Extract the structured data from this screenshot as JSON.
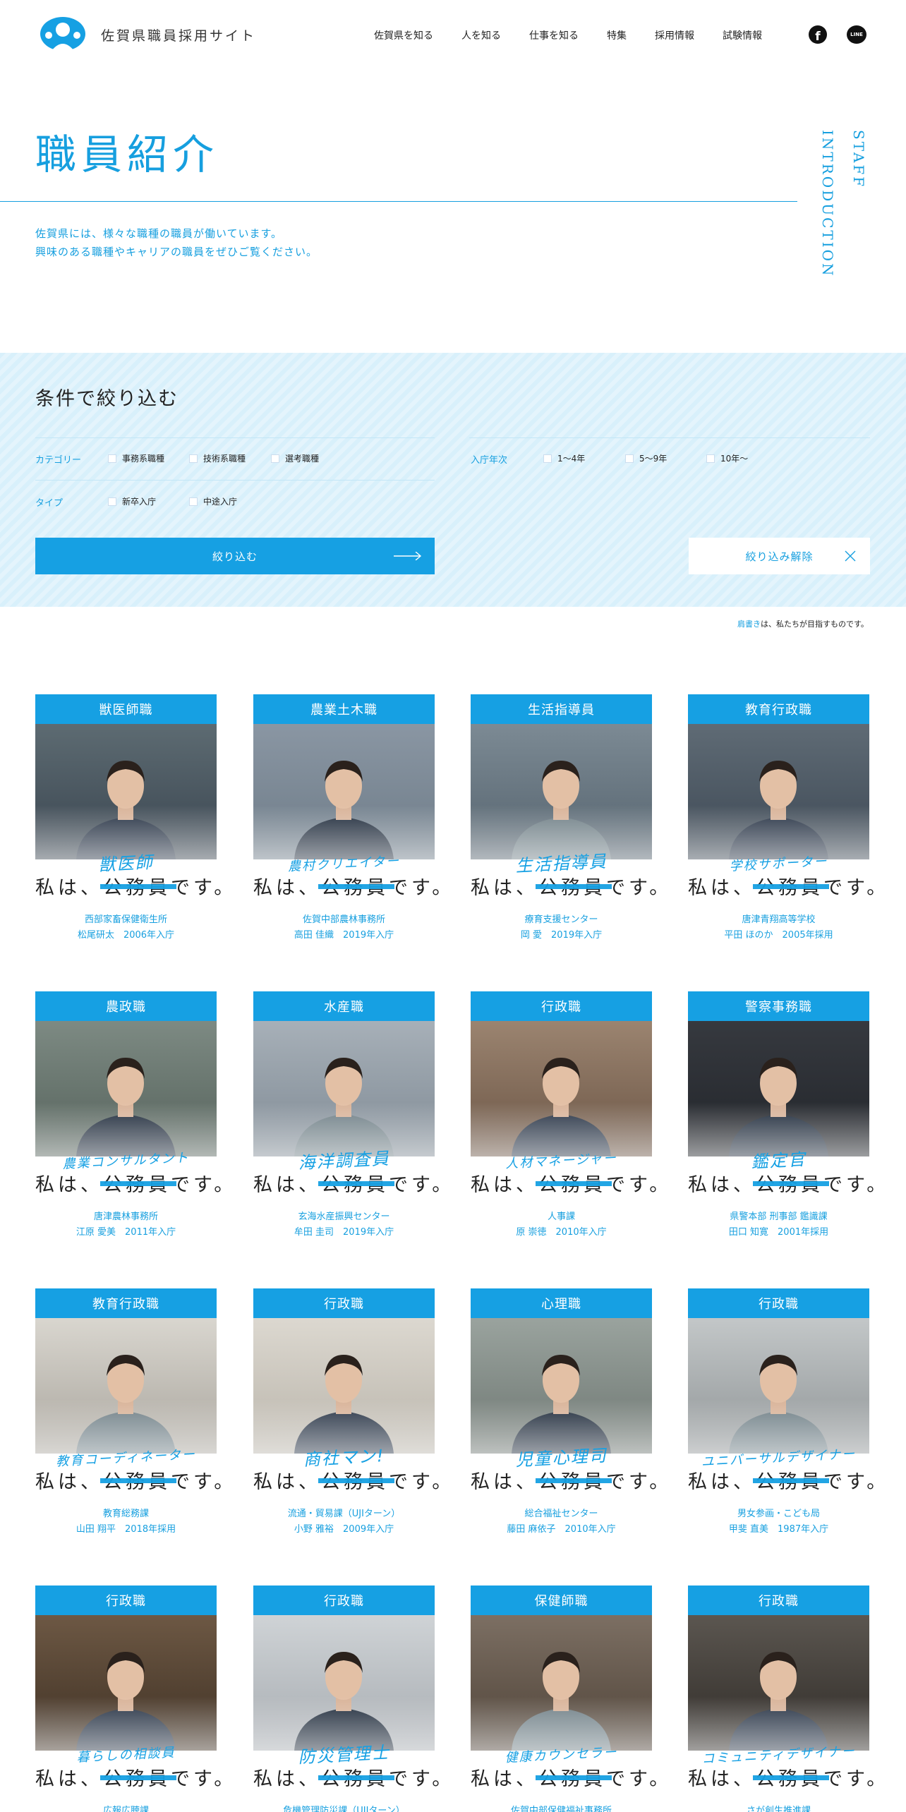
{
  "header": {
    "site_title": "佐賀県職員採用サイト",
    "nav": [
      "佐賀県を知る",
      "人を知る",
      "仕事を知る",
      "特集",
      "採用情報",
      "試験情報"
    ],
    "facebook": "f",
    "line": "LINE"
  },
  "hero": {
    "title": "職員紹介",
    "vertical_en_1": "STAFF",
    "vertical_en_2": "INTRODUCTION",
    "intro_1": "佐賀県には、様々な職種の職員が働いています。",
    "intro_2": "興味のある職種やキャリアの職員をぜひご覧ください。"
  },
  "filter": {
    "title": "条件で絞り込む",
    "category_label": "カテゴリー",
    "category_options": [
      "事務系職種",
      "技術系職種",
      "選考職種"
    ],
    "years_label": "入庁年次",
    "years_options": [
      "1〜4年",
      "5〜9年",
      "10年〜"
    ],
    "type_label": "タイプ",
    "type_options": [
      "新卒入庁",
      "中途入庁"
    ],
    "submit_label": "絞り込む",
    "reset_label": "絞り込み解除"
  },
  "note": {
    "highlight": "肩書き",
    "rest": "は、私たちが目指すものです。"
  },
  "phrase": {
    "pre": "私は、",
    "strike": "公務員",
    "post": "です。"
  },
  "cards": [
    {
      "job": "獣医師職",
      "title": "獣医師",
      "org": "西部家畜保健衛生所",
      "name": "松尾研太　2006年入庁"
    },
    {
      "job": "農業土木職",
      "title": "農村クリエイター",
      "org": "佐賀中部農林事務所",
      "name": "高田 佳織　2019年入庁"
    },
    {
      "job": "生活指導員",
      "title": "生活指導員",
      "org": "療育支援センター",
      "name": "岡 愛　2019年入庁"
    },
    {
      "job": "教育行政職",
      "title": "学校サポーター",
      "org": "唐津青翔高等学校",
      "name": "平田 ほのか　2005年採用"
    },
    {
      "job": "農政職",
      "title": "農業コンサルタント",
      "org": "唐津農林事務所",
      "name": "江原 愛美　2011年入庁"
    },
    {
      "job": "水産職",
      "title": "海洋調査員",
      "org": "玄海水産振興センター",
      "name": "牟田 圭司　2019年入庁"
    },
    {
      "job": "行政職",
      "title": "人材マネージャー",
      "org": "人事課",
      "name": "原 崇徳　2010年入庁"
    },
    {
      "job": "警察事務職",
      "title": "鑑定官",
      "org": "県警本部 刑事部 鑑識課",
      "name": "田口 知寛　2001年採用"
    },
    {
      "job": "教育行政職",
      "title": "教育コーディネーター",
      "org": "教育総務課",
      "name": "山田 翔平　2018年採用"
    },
    {
      "job": "行政職",
      "title": "商社マン!",
      "org": "流通・貿易課（UJIターン）",
      "name": "小野 雅裕　2009年入庁"
    },
    {
      "job": "心理職",
      "title": "児童心理司",
      "org": "総合福祉センター",
      "name": "藤田 麻依子　2010年入庁"
    },
    {
      "job": "行政職",
      "title": "ユニバーサルデザイナー",
      "org": "男女参画・こども局",
      "name": "甲斐 直美　1987年入庁"
    },
    {
      "job": "行政職",
      "title": "暮らしの相談員",
      "org": "広報広聴課",
      "name": ""
    },
    {
      "job": "行政職",
      "title": "防災管理士",
      "org": "危機管理防災課（UJIターン）",
      "name": ""
    },
    {
      "job": "保健師職",
      "title": "健康カウンセラー",
      "org": "佐賀中部保健福祉事務所",
      "name": ""
    },
    {
      "job": "行政職",
      "title": "コミュニティデザイナー",
      "org": "さが創生推進課",
      "name": ""
    }
  ],
  "colors": {
    "accent": "#16a0e3",
    "filter_bg": "#d8f0fb"
  }
}
